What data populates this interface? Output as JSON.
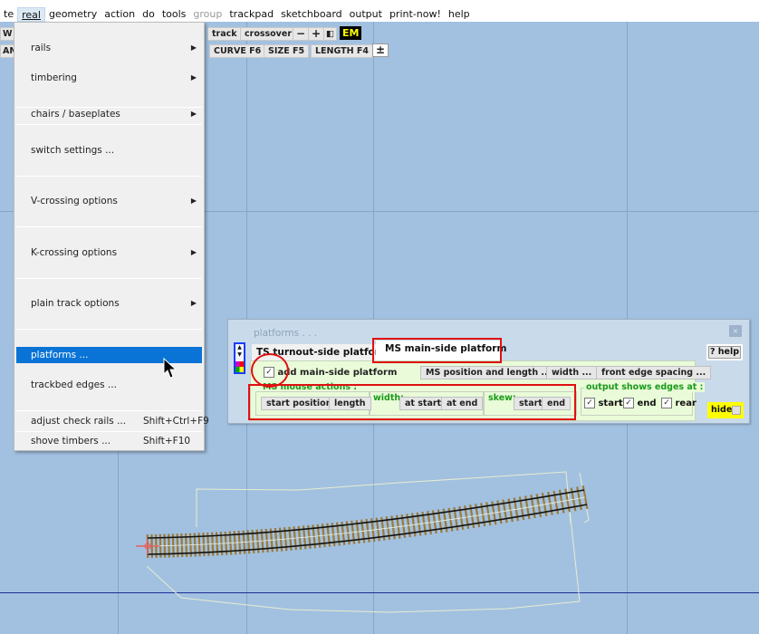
{
  "menubar": {
    "items": [
      {
        "label": "te",
        "state": "normal"
      },
      {
        "label": "real",
        "state": "active"
      },
      {
        "label": "geometry",
        "state": "normal"
      },
      {
        "label": "action",
        "state": "normal"
      },
      {
        "label": "do",
        "state": "normal"
      },
      {
        "label": "tools",
        "state": "normal"
      },
      {
        "label": "group",
        "state": "disabled"
      },
      {
        "label": "trackpad",
        "state": "normal"
      },
      {
        "label": "sketchboard",
        "state": "normal"
      },
      {
        "label": "output",
        "state": "normal"
      },
      {
        "label": "print-now!",
        "state": "normal"
      },
      {
        "label": "help",
        "state": "normal"
      }
    ]
  },
  "toolbar": {
    "row1": {
      "left_stub": "W",
      "track": "track",
      "crossover": "crossover",
      "minus": "−",
      "plus": "+",
      "fit": "◧",
      "em": "EM"
    },
    "row2": {
      "left_stub": "AM",
      "curve": "CURVE  F6",
      "size": "SIZE  F5",
      "length": "LENGTH  F4",
      "snap": "±"
    }
  },
  "dropdown": {
    "items": [
      {
        "label": "rails",
        "submenu": true
      },
      {
        "label": "timbering",
        "submenu": true
      },
      {
        "label": "chairs / baseplates",
        "submenu": true
      },
      {
        "label": "switch  settings ...",
        "submenu": false
      },
      {
        "label": "V-crossing  options",
        "submenu": true
      },
      {
        "label": "K-crossing  options",
        "submenu": true
      },
      {
        "label": "plain  track  options",
        "submenu": true
      },
      {
        "label": "platforms ...",
        "submenu": false,
        "highlighted": true
      },
      {
        "label": "trackbed  edges ...",
        "submenu": false
      },
      {
        "label": "adjust  check  rails ...",
        "shortcut": "Shift+Ctrl+F9"
      },
      {
        "label": "shove  timbers ...",
        "shortcut": "Shift+F10"
      }
    ],
    "arrow": "▶"
  },
  "dialog": {
    "title": "platforms . . .",
    "close": "×",
    "tabs": [
      {
        "label": "TS  turnout-side  platform",
        "active": false
      },
      {
        "label": "MS  main-side  platform",
        "active": true
      }
    ],
    "add_checkbox": {
      "label": "add  main-side  platform",
      "checked": true
    },
    "buttons": {
      "position_length": "MS  position  and  length ...",
      "width": "width ...",
      "front_edge": "front  edge  spacing ..."
    },
    "mouse_actions": {
      "label": "MS  mouse actions :",
      "start_position": "start  position",
      "length": "length"
    },
    "width_group": {
      "label": "width:",
      "at_start": "at  start",
      "at_end": "at  end"
    },
    "skew_group": {
      "label": "skew:",
      "start": "start",
      "end": "end"
    },
    "output_edges": {
      "label": "output shows edges at :",
      "start": {
        "label": "start",
        "checked": true
      },
      "end": {
        "label": "end",
        "checked": true
      },
      "rear": {
        "label": "rear",
        "checked": true
      }
    },
    "help": "? help",
    "hide": "hide",
    "check_glyph": "✓",
    "spin_up": "▲",
    "spin_down": "▼"
  },
  "colors": {
    "canvas": "#a2c1e0",
    "menu_highlight": "#0a74d6",
    "annotation_red": "#e01010",
    "panel_green": "#e9fbd8",
    "label_green": "#1a9a1a",
    "em_yellow": "#ffff00",
    "timber_brown": "#9a7a3a",
    "rail_black": "#111111"
  }
}
